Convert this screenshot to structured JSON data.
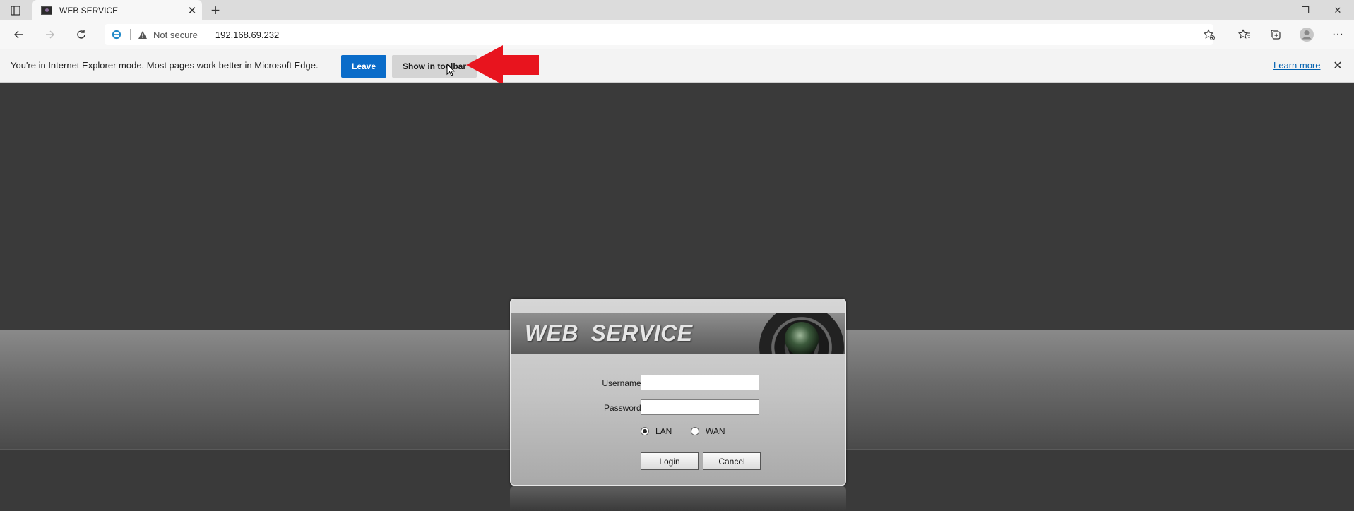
{
  "browser": {
    "tab": {
      "title": "WEB SERVICE"
    },
    "address": {
      "security_label": "Not secure",
      "url": "192.168.69.232"
    },
    "icons": {
      "tab_actions": "tab-actions-icon",
      "new_tab": "plus-icon",
      "back": "back-arrow-icon",
      "forward": "forward-arrow-icon",
      "refresh": "refresh-icon",
      "ie": "internet-explorer-icon",
      "warning": "warning-triangle-icon",
      "add_favorite": "star-plus-icon",
      "favorites": "favorites-icon",
      "collections": "collections-icon",
      "profile": "profile-icon",
      "menu": "more-menu-icon"
    }
  },
  "infobar": {
    "message": "You're in Internet Explorer mode. Most pages work better in Microsoft Edge.",
    "leave_label": "Leave",
    "show_toolbar_label": "Show in toolbar",
    "learn_more_label": "Learn more",
    "annotation": "red-arrow-pointing-left",
    "colors": {
      "leave_button": "#0a6cc9",
      "arrow": "#e8141e"
    }
  },
  "login": {
    "title": "WEB SERVICE",
    "username_label": "Username:",
    "username_value": "",
    "password_label": "Password:",
    "password_value": "",
    "network_options": [
      {
        "label": "LAN",
        "selected": true
      },
      {
        "label": "WAN",
        "selected": false
      }
    ],
    "login_label": "Login",
    "cancel_label": "Cancel"
  }
}
